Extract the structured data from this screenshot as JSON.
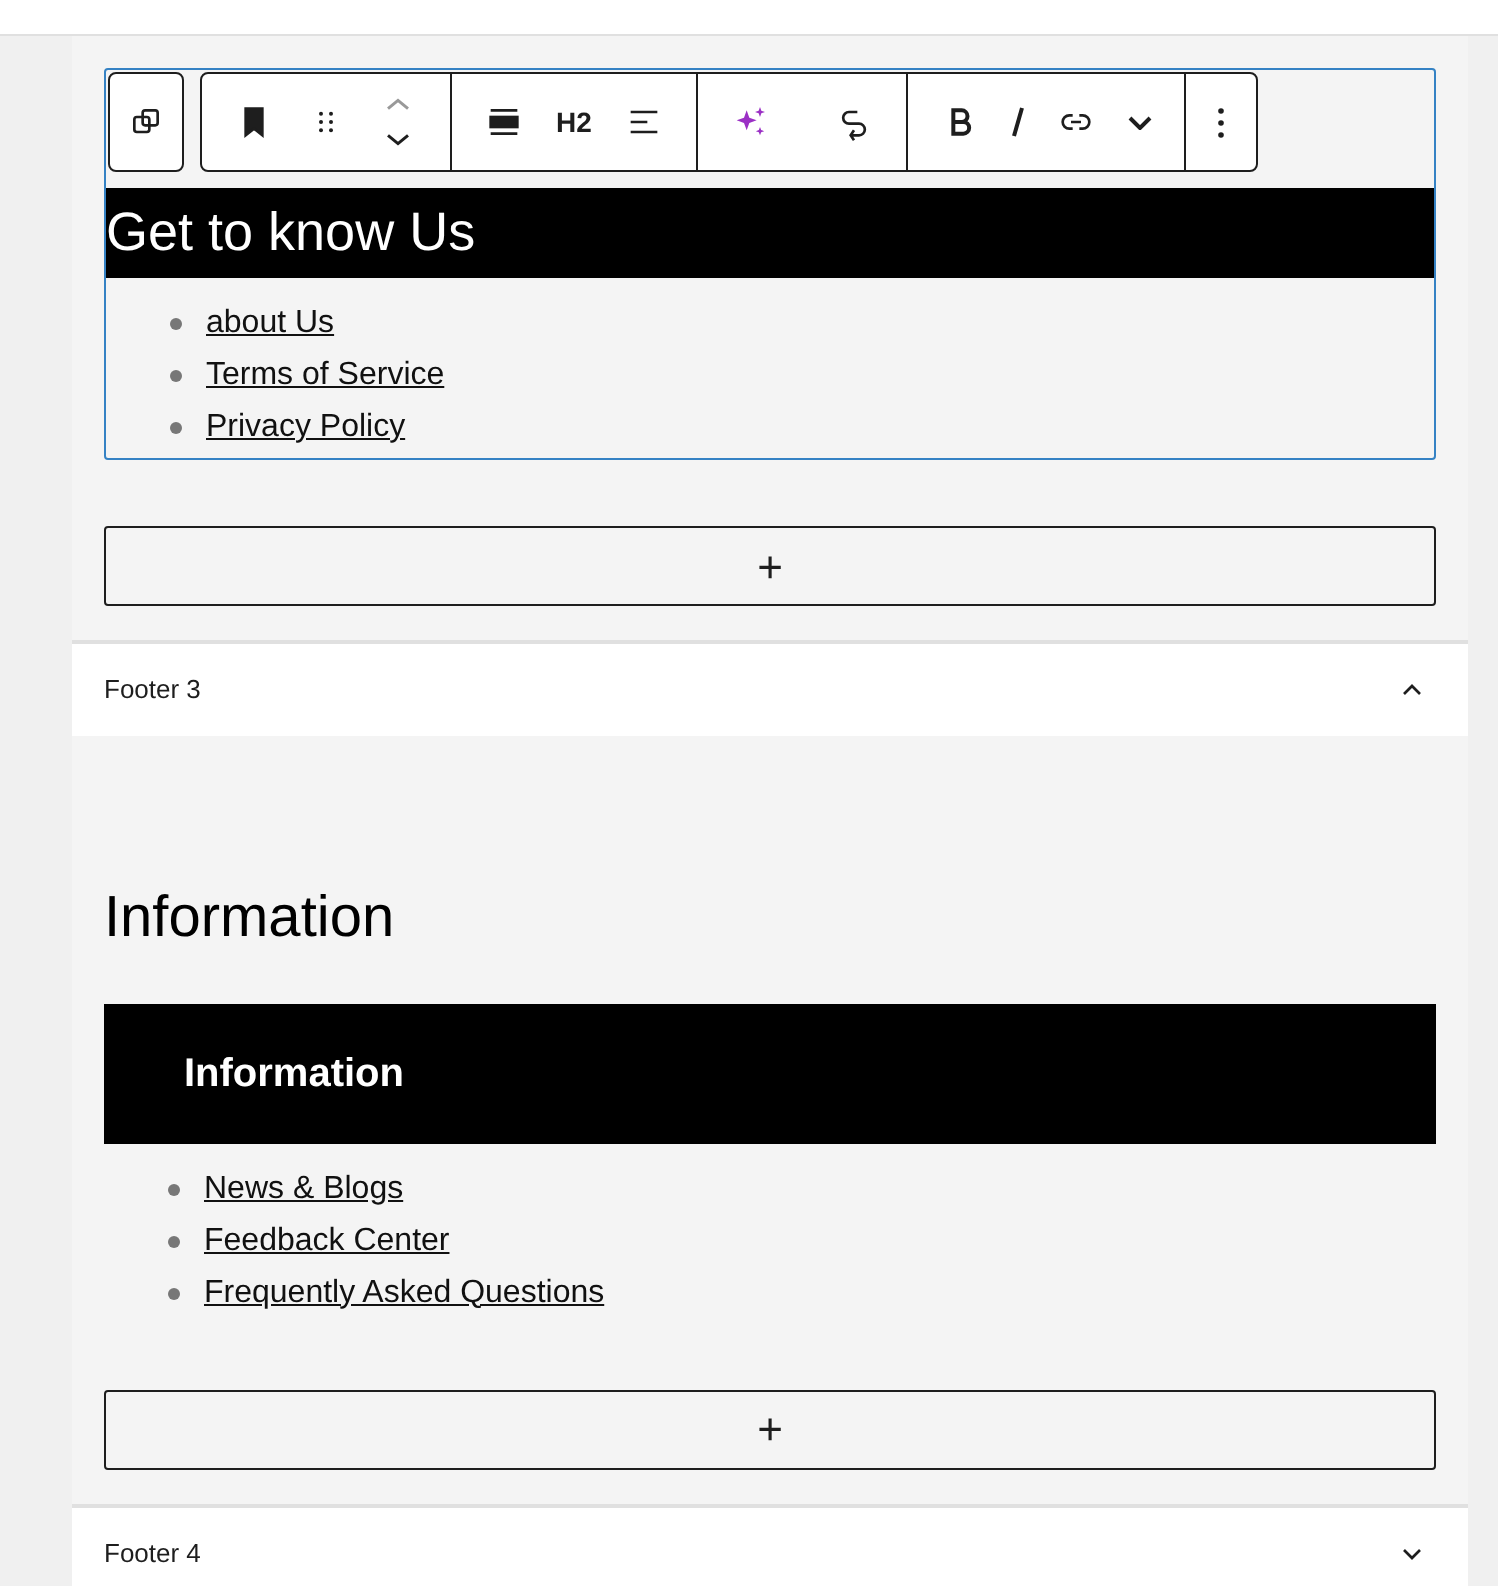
{
  "toolbar": {
    "heading_level": "H2"
  },
  "sections": [
    {
      "bar_title": "Get to know Us",
      "kind": "large",
      "selected": true,
      "links": [
        "about Us",
        "Terms of Service",
        "Privacy Policy"
      ],
      "add_label": "+"
    },
    {
      "header": {
        "title": "Footer 3",
        "expanded": true
      },
      "heading": "Information",
      "bar_title": "Information",
      "kind": "small",
      "selected": false,
      "links": [
        "News & Blogs",
        "Feedback Center",
        "Frequently Asked Questions"
      ],
      "add_label": "+"
    }
  ],
  "collapsed_panel": {
    "title": "Footer 4",
    "expanded": false
  }
}
